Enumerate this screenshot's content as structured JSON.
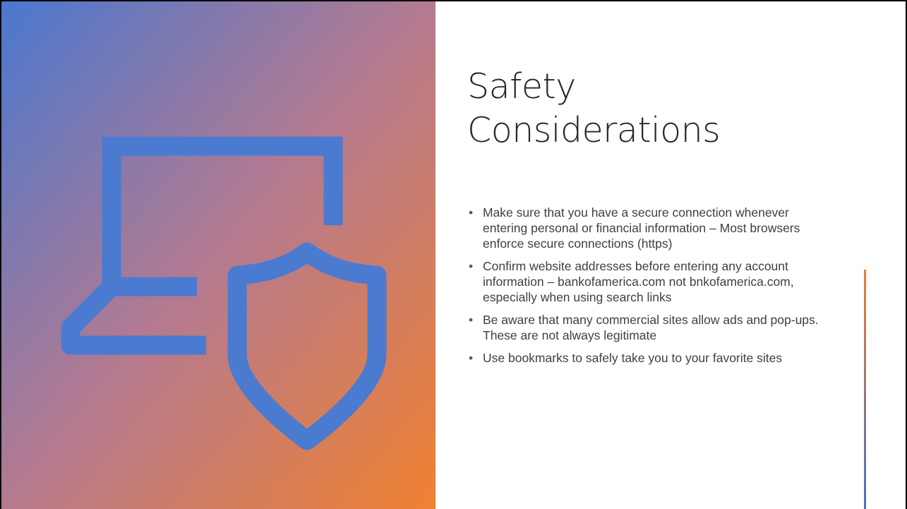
{
  "slide": {
    "title_line_1": "Safety",
    "title_line_2": "Considerations",
    "bullets": [
      "Make sure that you have a secure connection whenever entering personal or financial information – Most browsers enforce secure connections (https)",
      "Confirm website addresses before entering any account information – bankofamerica.com not bnkofamerica.com, especially when using search links",
      "Be aware that many commercial sites allow ads and pop-ups.  These are not always legitimate",
      "Use bookmarks to safely take you to your favorite sites"
    ],
    "bullet_glyph": "•"
  },
  "art": {
    "icons": [
      "laptop-icon",
      "shield-icon"
    ],
    "gradient_start": "#4a78cf",
    "gradient_mid": "#b57a8f",
    "gradient_end": "#f08130",
    "icon_color": "#4a7bd1"
  },
  "accent": {
    "top_color": "#ee7d31",
    "bottom_color": "#4472c4"
  }
}
